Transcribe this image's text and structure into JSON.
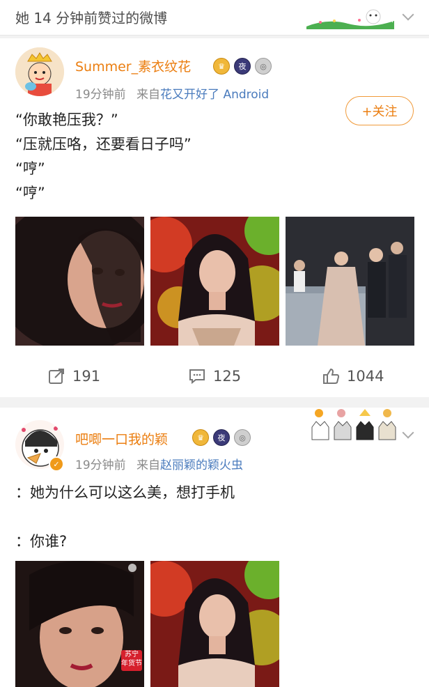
{
  "header": {
    "title": "她 14 分钟前赞过的微博"
  },
  "posts": [
    {
      "user": "Summer_素衣纹花",
      "badges": [
        "夜"
      ],
      "time": "19分钟前",
      "from_prefix": "来自",
      "source": "花又开好了 Android",
      "follow_label": "+关注",
      "text": "“你敢艳压我？”\n“压就压咯，还要看日子吗”\n“哼”\n“哼”",
      "actions": {
        "repost": "191",
        "comment": "125",
        "like": "1044"
      }
    },
    {
      "user": "吧唧一口我的颖",
      "badges": [
        "夜"
      ],
      "time": "19分钟前",
      "from_prefix": "来自",
      "source": "赵丽颖的颖火虫",
      "text": "：她为什么可以这么美，想打手机\n\n：你谁?",
      "image_overlay": "苏宁\n年货节"
    }
  ],
  "colors": {
    "accent": "#eb7e10",
    "link": "#4a7bbd"
  }
}
